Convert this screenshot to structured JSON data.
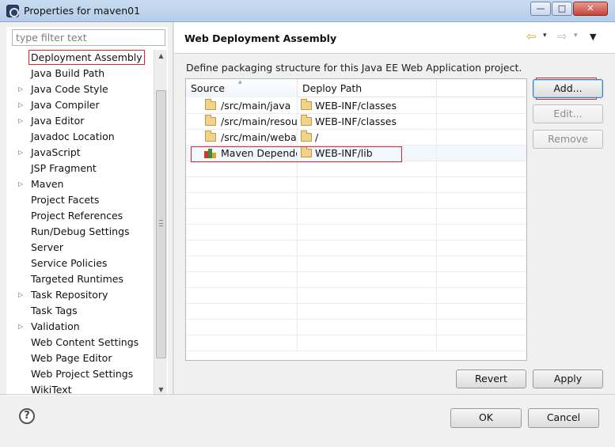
{
  "window": {
    "title": "Properties for maven01",
    "controls": {
      "minimize": "—",
      "maximize": "□",
      "close": "✕"
    }
  },
  "filter": {
    "placeholder": "type filter text",
    "value": ""
  },
  "tree": {
    "items": [
      {
        "label": "Deployment Assembly",
        "expandable": false,
        "selected": true
      },
      {
        "label": "Java Build Path",
        "expandable": false
      },
      {
        "label": "Java Code Style",
        "expandable": true
      },
      {
        "label": "Java Compiler",
        "expandable": true
      },
      {
        "label": "Java Editor",
        "expandable": true
      },
      {
        "label": "Javadoc Location",
        "expandable": false
      },
      {
        "label": "JavaScript",
        "expandable": true
      },
      {
        "label": "JSP Fragment",
        "expandable": false
      },
      {
        "label": "Maven",
        "expandable": true
      },
      {
        "label": "Project Facets",
        "expandable": false
      },
      {
        "label": "Project References",
        "expandable": false
      },
      {
        "label": "Run/Debug Settings",
        "expandable": false
      },
      {
        "label": "Server",
        "expandable": false
      },
      {
        "label": "Service Policies",
        "expandable": false
      },
      {
        "label": "Targeted Runtimes",
        "expandable": false
      },
      {
        "label": "Task Repository",
        "expandable": true
      },
      {
        "label": "Task Tags",
        "expandable": false
      },
      {
        "label": "Validation",
        "expandable": true
      },
      {
        "label": "Web Content Settings",
        "expandable": false
      },
      {
        "label": "Web Page Editor",
        "expandable": false
      },
      {
        "label": "Web Project Settings",
        "expandable": false
      },
      {
        "label": "WikiText",
        "expandable": false
      }
    ],
    "expand_glyph": "▷"
  },
  "page": {
    "title": "Web Deployment Assembly",
    "description": "Define packaging structure for this Java EE Web Application project.",
    "nav": {
      "back_icon": "back-arrow-icon",
      "forward_icon": "forward-arrow-icon",
      "back_glyph": "⇦",
      "forward_glyph": "⇨",
      "menu_glyph": "▾"
    }
  },
  "table": {
    "columns": [
      "Source",
      "Deploy Path",
      ""
    ],
    "rows": [
      {
        "source": "/src/main/java",
        "source_icon": "folder-icon",
        "deploy_path": "WEB-INF/classes"
      },
      {
        "source": "/src/main/resources",
        "source_icon": "folder-icon",
        "deploy_path": "WEB-INF/classes"
      },
      {
        "source": "/src/main/webapp",
        "source_icon": "folder-icon",
        "deploy_path": "/"
      },
      {
        "source": "Maven Dependencies",
        "source_icon": "maven-library-icon",
        "deploy_path": "WEB-INF/lib",
        "highlighted": true
      }
    ],
    "empty_rows": 12
  },
  "buttons": {
    "add": "Add...",
    "edit": "Edit...",
    "remove": "Remove",
    "revert": "Revert",
    "apply": "Apply",
    "ok": "OK",
    "cancel": "Cancel"
  },
  "help": {
    "icon": "help-icon",
    "glyph": "?"
  },
  "colors": {
    "annotation_red": "#e0242b",
    "title_bar": "#c9dcf0",
    "dialog_bg": "#f0f0f0"
  }
}
